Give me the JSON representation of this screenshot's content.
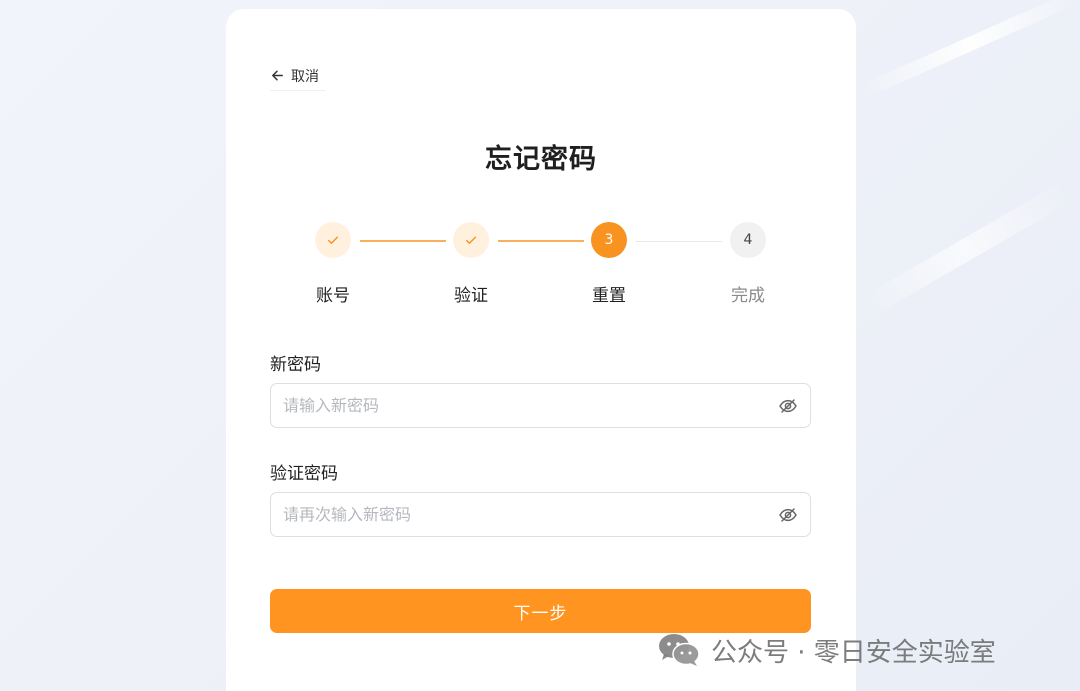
{
  "back": {
    "label": "取消",
    "icon": "arrow-left-icon"
  },
  "title": "忘记密码",
  "steps": [
    {
      "label": "账号",
      "status": "done",
      "icon": "check-icon"
    },
    {
      "label": "验证",
      "status": "done",
      "icon": "check-icon"
    },
    {
      "label": "重置",
      "status": "current",
      "number": "3"
    },
    {
      "label": "完成",
      "status": "todo",
      "number": "4"
    }
  ],
  "form": {
    "new_password": {
      "label": "新密码",
      "placeholder": "请输入新密码",
      "value": "",
      "icon": "eye-off-icon"
    },
    "confirm_password": {
      "label": "验证密码",
      "placeholder": "请再次输入新密码",
      "value": "",
      "icon": "eye-off-icon"
    }
  },
  "next_button": "下一步",
  "watermark": {
    "text": "公众号 · 零日安全实验室",
    "icon": "wechat-icon"
  },
  "colors": {
    "accent": "#ff9420",
    "accent_light": "#fff1dd",
    "line_done": "#f8b15a"
  }
}
